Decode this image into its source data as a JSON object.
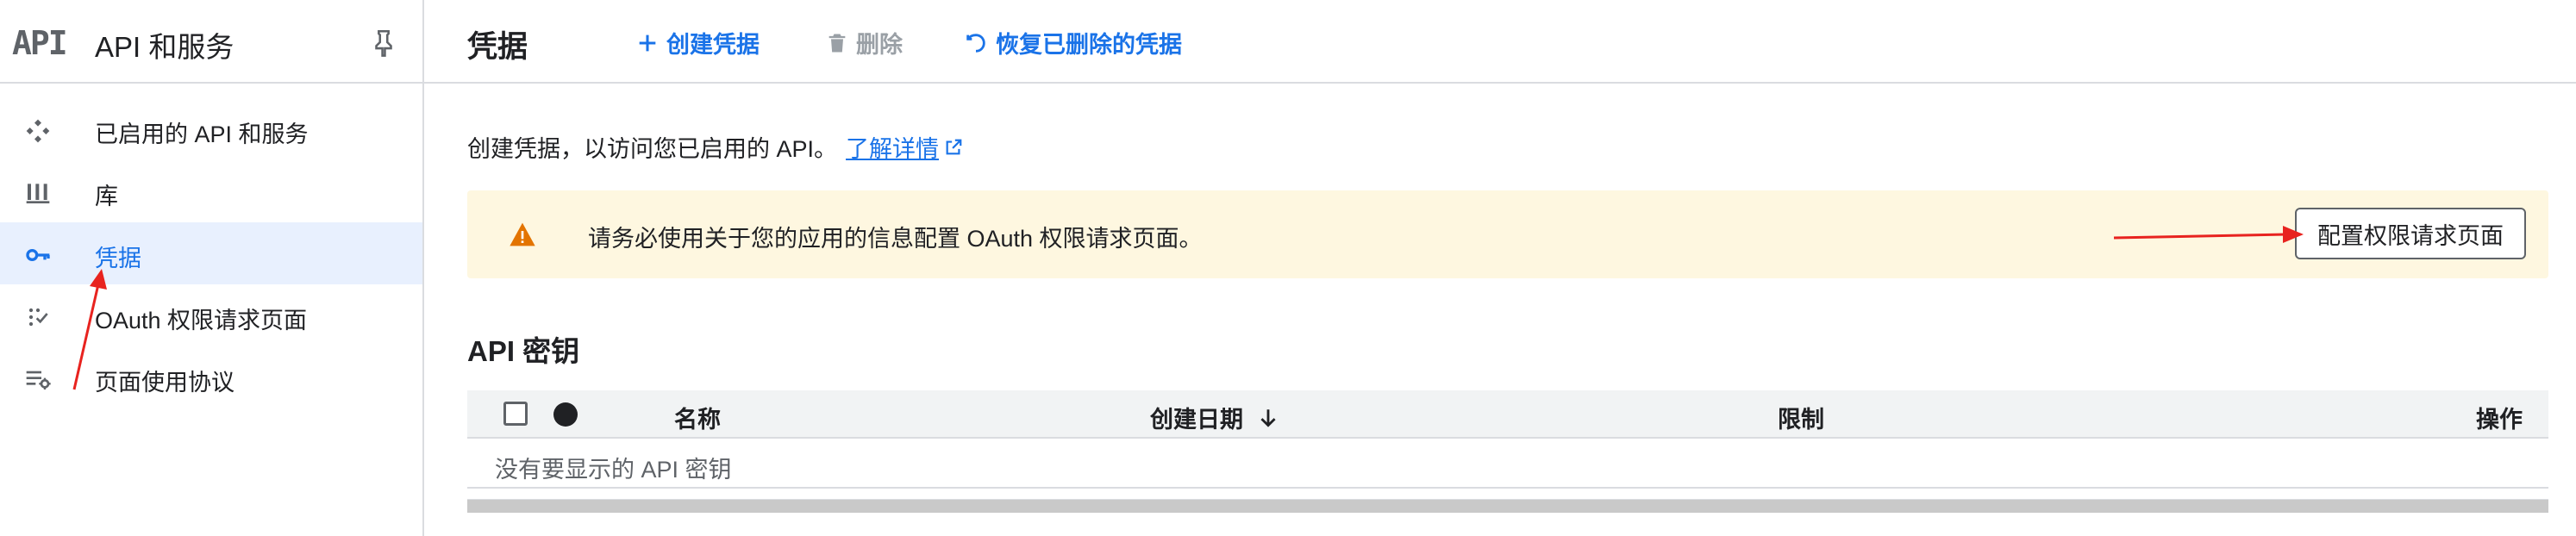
{
  "sidebar": {
    "logo": "API",
    "title": "API 和服务",
    "pin_icon": "pin-icon",
    "items": [
      {
        "label": "已启用的 API 和服务",
        "icon": "api-services-icon",
        "active": false
      },
      {
        "label": "库",
        "icon": "library-icon",
        "active": false
      },
      {
        "label": "凭据",
        "icon": "key-icon",
        "active": true
      },
      {
        "label": "OAuth 权限请求页面",
        "icon": "oauth-consent-icon",
        "active": false
      },
      {
        "label": "页面使用协议",
        "icon": "page-agreements-icon",
        "active": false
      }
    ]
  },
  "topbar": {
    "title": "凭据",
    "create_label": "创建凭据",
    "delete_label": "删除",
    "restore_label": "恢复已删除的凭据"
  },
  "main": {
    "intro_text": "创建凭据，以访问您已启用的 API。",
    "learn_more": "了解详情",
    "banner": {
      "text": "请务必使用关于您的应用的信息配置 OAuth 权限请求页面。",
      "button": "配置权限请求页面"
    },
    "api_keys": {
      "title": "API 密钥",
      "columns": {
        "name": "名称",
        "created": "创建日期",
        "restrictions": "限制",
        "actions": "操作"
      },
      "empty_text": "没有要显示的 API 密钥"
    }
  },
  "colors": {
    "accent": "#1a73e8",
    "active_bg": "#e8f0fe",
    "banner_bg": "#fef7e0",
    "warning": "#e37400",
    "annotation": "#e8231f"
  }
}
